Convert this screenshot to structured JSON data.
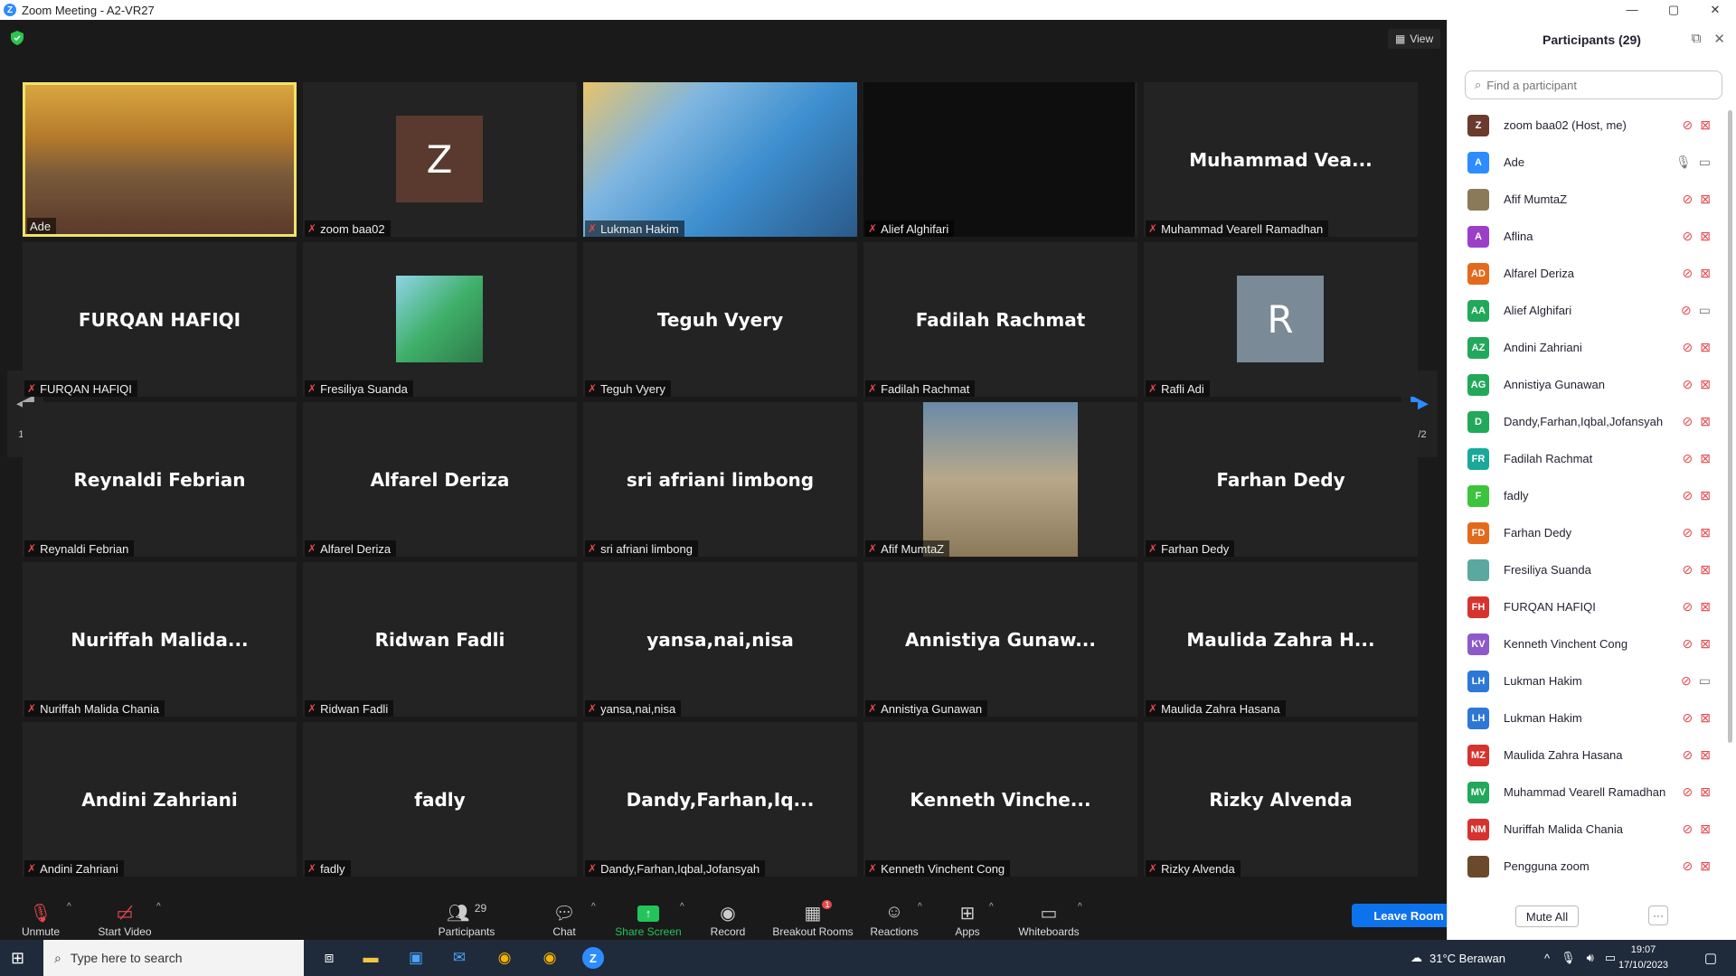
{
  "window": {
    "title": "Zoom Meeting - A2-VR27",
    "controls": [
      "—",
      "▢",
      "✕"
    ]
  },
  "meeting": {
    "view_label": "View",
    "page_indicator_left": "1/2",
    "page_indicator_right": "1/2",
    "tiles": [
      {
        "big": "",
        "label": "Ade",
        "muted": false,
        "video": true,
        "active": true
      },
      {
        "big": "",
        "label": "zoom baa02",
        "muted": true,
        "avatar": "Z",
        "avatar_color": "#5a3a2e"
      },
      {
        "big": "",
        "label": "Lukman Hakim",
        "muted": true,
        "video": true
      },
      {
        "big": "",
        "label": "Alief Alghifari",
        "muted": true,
        "video": true
      },
      {
        "big": "Muhammad  Vea...",
        "label": "Muhammad Vearell Ramadhan",
        "muted": true
      },
      {
        "big": "FURQAN HAFIQI",
        "label": "FURQAN HAFIQI",
        "muted": true
      },
      {
        "big": "",
        "label": "Fresiliya Suanda",
        "muted": true,
        "avatar_img": true
      },
      {
        "big": "Teguh Vyery",
        "label": "Teguh Vyery",
        "muted": true
      },
      {
        "big": "Fadilah Rachmat",
        "label": "Fadilah Rachmat",
        "muted": true
      },
      {
        "big": "",
        "label": "Rafli Adi",
        "muted": true,
        "avatar": "R",
        "avatar_color": "#7a8a96"
      },
      {
        "big": "Reynaldi Febrian",
        "label": "Reynaldi Febrian",
        "muted": true
      },
      {
        "big": "Alfarel Deriza",
        "label": "Alfarel Deriza",
        "muted": true
      },
      {
        "big": "sri afriani limbong",
        "label": "sri afriani limbong",
        "muted": true
      },
      {
        "big": "",
        "label": "Afif MumtaZ",
        "muted": true,
        "video": true
      },
      {
        "big": "Farhan Dedy",
        "label": "Farhan Dedy",
        "muted": true
      },
      {
        "big": "Nuriffah  Malida...",
        "label": "Nuriffah Malida Chania",
        "muted": true
      },
      {
        "big": "Ridwan Fadli",
        "label": "Ridwan Fadli",
        "muted": true
      },
      {
        "big": "yansa,nai,nisa",
        "label": "yansa,nai,nisa",
        "muted": true
      },
      {
        "big": "Annistiya  Gunaw...",
        "label": "Annistiya Gunawan",
        "muted": true
      },
      {
        "big": "Maulida Zahra H...",
        "label": "Maulida Zahra Hasana",
        "muted": true
      },
      {
        "big": "Andini Zahriani",
        "label": "Andini Zahriani",
        "muted": true
      },
      {
        "big": "fadly",
        "label": "fadly",
        "muted": true
      },
      {
        "big": "Dandy,Farhan,Iq...",
        "label": "Dandy,Farhan,Iqbal,Jofansyah",
        "muted": true
      },
      {
        "big": "Kenneth  Vinche...",
        "label": "Kenneth Vinchent Cong",
        "muted": true
      },
      {
        "big": "Rizky Alvenda",
        "label": "Rizky Alvenda",
        "muted": true
      }
    ]
  },
  "toolbar": {
    "unmute": "Unmute",
    "start_video": "Start Video",
    "participants": "Participants",
    "participants_count": "29",
    "chat": "Chat",
    "share_screen": "Share Screen",
    "record": "Record",
    "breakout_rooms": "Breakout Rooms",
    "breakout_badge": "1",
    "reactions": "Reactions",
    "apps": "Apps",
    "whiteboards": "Whiteboards",
    "leave_room": "Leave Room"
  },
  "panel": {
    "title": "Participants (29)",
    "search_placeholder": "Find a participant",
    "mute_all": "Mute All",
    "more": "···",
    "participants": [
      {
        "initials": "Z",
        "color": "#6b3b2e",
        "name": "zoom baa02 (Host, me)",
        "mic_on": false,
        "cam_on": false
      },
      {
        "initials": "A",
        "color": "#2d8cff",
        "name": "Ade",
        "mic_on": true,
        "cam_on": true
      },
      {
        "initials": "",
        "color": "#8a7a5a",
        "name": "Afif MumtaZ",
        "mic_on": false,
        "cam_on": false
      },
      {
        "initials": "A",
        "color": "#9b3fc9",
        "name": "Aflina",
        "mic_on": false,
        "cam_on": false
      },
      {
        "initials": "AD",
        "color": "#e36a1d",
        "name": "Alfarel Deriza",
        "mic_on": false,
        "cam_on": false
      },
      {
        "initials": "AA",
        "color": "#22a85a",
        "name": "Alief Alghifari",
        "mic_on": false,
        "cam_on": true
      },
      {
        "initials": "AZ",
        "color": "#22a85a",
        "name": "Andini Zahriani",
        "mic_on": false,
        "cam_on": false
      },
      {
        "initials": "AG",
        "color": "#22a85a",
        "name": "Annistiya Gunawan",
        "mic_on": false,
        "cam_on": false
      },
      {
        "initials": "D",
        "color": "#22a85a",
        "name": "Dandy,Farhan,Iqbal,Jofansyah",
        "mic_on": false,
        "cam_on": false
      },
      {
        "initials": "FR",
        "color": "#1aa89a",
        "name": "Fadilah Rachmat",
        "mic_on": false,
        "cam_on": false
      },
      {
        "initials": "F",
        "color": "#3cc43c",
        "name": "fadly",
        "mic_on": false,
        "cam_on": false
      },
      {
        "initials": "FD",
        "color": "#e36a1d",
        "name": "Farhan Dedy",
        "mic_on": false,
        "cam_on": false
      },
      {
        "initials": "",
        "color": "#5aa8a0",
        "name": "Fresiliya Suanda",
        "mic_on": false,
        "cam_on": false
      },
      {
        "initials": "FH",
        "color": "#d6332f",
        "name": "FURQAN HAFIQI",
        "mic_on": false,
        "cam_on": false
      },
      {
        "initials": "KV",
        "color": "#8e5ac9",
        "name": "Kenneth Vinchent Cong",
        "mic_on": false,
        "cam_on": false
      },
      {
        "initials": "LH",
        "color": "#2d78d6",
        "name": "Lukman Hakim",
        "mic_on": false,
        "cam_on": true
      },
      {
        "initials": "LH",
        "color": "#2d78d6",
        "name": "Lukman Hakim",
        "mic_on": false,
        "cam_on": false
      },
      {
        "initials": "MZ",
        "color": "#d6332f",
        "name": "Maulida Zahra Hasana",
        "mic_on": false,
        "cam_on": false
      },
      {
        "initials": "MV",
        "color": "#22a85a",
        "name": "Muhammad Vearell Ramadhan",
        "mic_on": false,
        "cam_on": false
      },
      {
        "initials": "NM",
        "color": "#d6332f",
        "name": "Nuriffah Malida Chania",
        "mic_on": false,
        "cam_on": false
      },
      {
        "initials": "",
        "color": "#6a4a2a",
        "name": "Pengguna zoom",
        "mic_on": false,
        "cam_on": false
      }
    ]
  },
  "taskbar": {
    "search_placeholder": "Type here to search",
    "weather": "31°C  Berawan",
    "time": "19:07",
    "date": "17/10/2023"
  }
}
